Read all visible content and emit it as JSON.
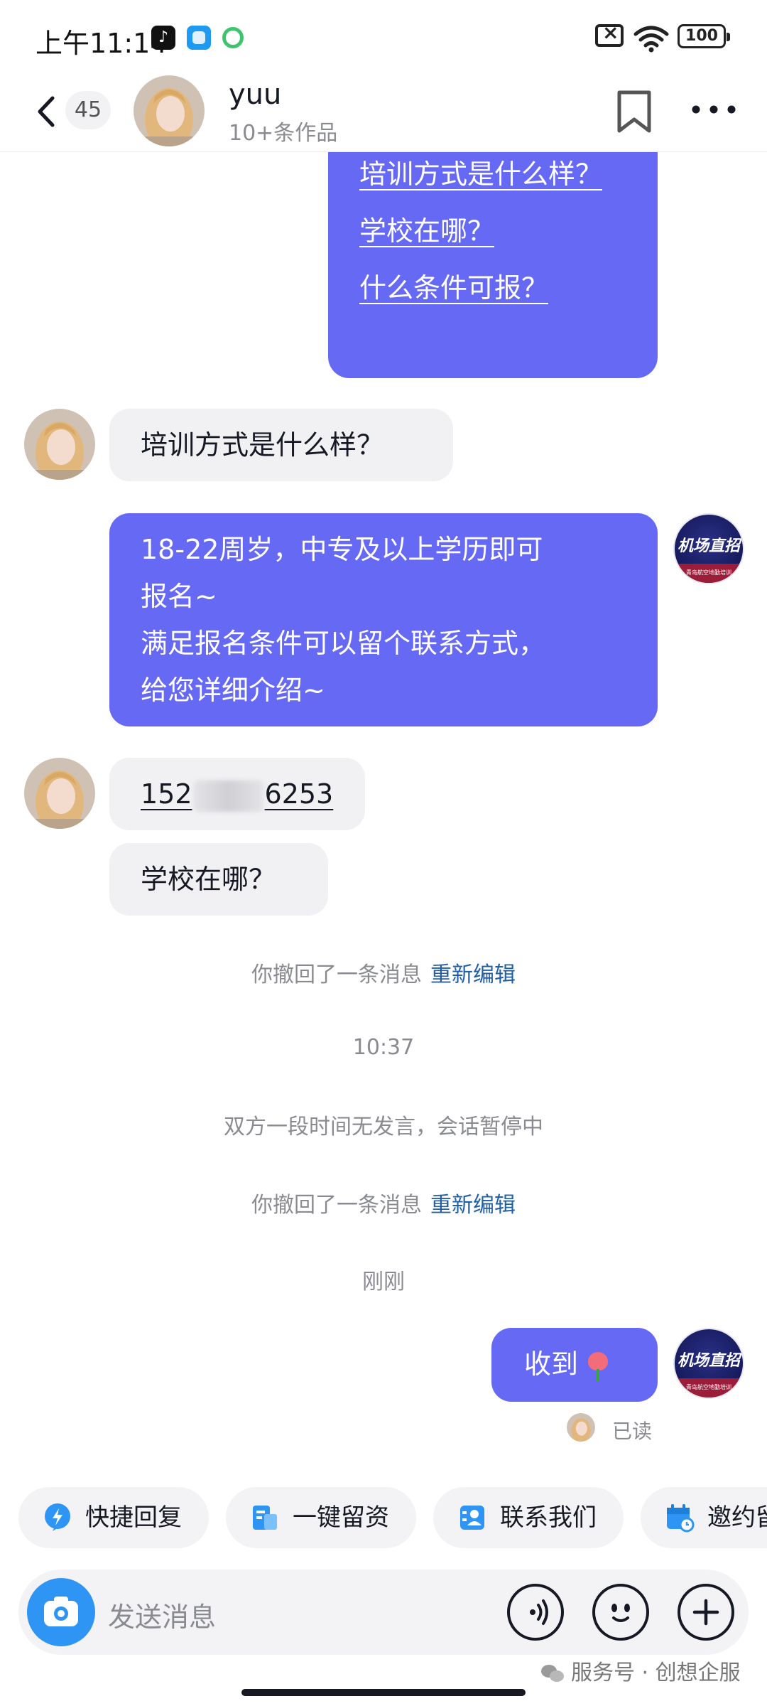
{
  "status_bar": {
    "time": "上午11:14",
    "battery": "100"
  },
  "header": {
    "unread_count": "45",
    "name": "yuu",
    "subtitle": "10+条作品"
  },
  "brand": {
    "name": "机场直招",
    "sub": "青岛航空地勤培训"
  },
  "messages": {
    "menu_options": [
      "培训方式是什么样？",
      "学校在哪？",
      "什么条件可报？"
    ],
    "user_q1": "培训方式是什么样？",
    "reply1_lines": [
      "18-22周岁，中专及以上学历即可",
      "报名~",
      "满足报名条件可以留个联系方式，",
      "给您详细介绍~"
    ],
    "phone_prefix": "152",
    "phone_suffix": "6253",
    "user_q2": "学校在哪？",
    "recall_text": "你撤回了一条消息",
    "recall_action": "重新编辑",
    "time_1037": "10:37",
    "pause_notice": "双方一段时间无发言，会话暂停中",
    "recall_text_2": "你撤回了一条消息",
    "recall_action_2": "重新编辑",
    "time_just_now": "刚刚",
    "reply_received": "收到",
    "read_status": "已读"
  },
  "quick_actions": [
    {
      "label": "快捷回复",
      "icon": "lightning-icon"
    },
    {
      "label": "一键留资",
      "icon": "form-icon"
    },
    {
      "label": "联系我们",
      "icon": "contact-card-icon"
    },
    {
      "label": "邀约留",
      "icon": "calendar-icon"
    }
  ],
  "input": {
    "placeholder": "发送消息"
  },
  "watermark": "服务号 · 创想企服",
  "colors": {
    "accent": "#6669f4",
    "link_blue": "#1f5fa8",
    "camera_blue": "#2f95f4"
  }
}
